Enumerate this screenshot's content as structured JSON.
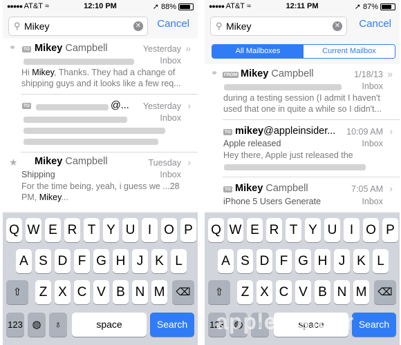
{
  "left": {
    "status": {
      "carrier": "AT&T",
      "time": "12:10 PM",
      "battery": "88%"
    },
    "search": {
      "query": "Mikey",
      "cancel": "Cancel"
    },
    "messages": [
      {
        "first": "Mikey",
        "rest": " Campbell",
        "date": "Yesterday",
        "mailbox": "Inbox",
        "l1_a": "Hi ",
        "l1_b": "Mikey",
        "l1_c": ", Thanks. They had a change of",
        "l2": "shipping guys and it looks like a few req..."
      },
      {
        "date": "Yesterday",
        "mailbox": "Inbox",
        "at": "@..."
      },
      {
        "first": "Mikey",
        "rest": " Campbell",
        "date": "Tuesday",
        "subject": "Shipping",
        "mailbox": "Inbox",
        "l1": "For the time being, yeah, i guess we ...28",
        "l2_a": "PM, ",
        "l2_b": "Mikey",
        "l2_c": "..."
      }
    ],
    "tags": {
      "to": "TO"
    }
  },
  "right": {
    "status": {
      "carrier": "AT&T",
      "time": "12:11 PM",
      "battery": "87%"
    },
    "search": {
      "query": "Mikey",
      "cancel": "Cancel"
    },
    "scope": {
      "all": "All Mailboxes",
      "current": "Current Mailbox"
    },
    "messages": [
      {
        "first": "Mikey",
        "rest": " Campbell",
        "date": "1/18/13",
        "mailbox": "Inbox",
        "l1": "during a testing session (I admit I haven't",
        "l2": "used that one in quite a while so I didn't..."
      },
      {
        "first": "mikey",
        "rest": "@appleinsider...",
        "date": "10:09 AM",
        "subject": "Apple released",
        "mailbox": "Inbox",
        "l1": "Hey there, Apple just released the"
      },
      {
        "first": "Mikey",
        "rest": " Campbell",
        "date": "7:05 AM",
        "subject": "iPhone 5 Users Generate",
        "mailbox": "Inbox"
      }
    ],
    "tags": {
      "from": "FROM",
      "to": "TO"
    }
  },
  "keyboard": {
    "row1": [
      "Q",
      "W",
      "E",
      "R",
      "T",
      "Y",
      "U",
      "I",
      "O",
      "P"
    ],
    "row2": [
      "A",
      "S",
      "D",
      "F",
      "G",
      "H",
      "J",
      "K",
      "L"
    ],
    "row3": [
      "Z",
      "X",
      "C",
      "V",
      "B",
      "N",
      "M"
    ],
    "numbers": "123",
    "space": "space",
    "search": "Search",
    "shift_icon": "shift-icon",
    "delete_icon": "delete-icon",
    "globe_icon": "globe-icon",
    "mic_icon": "mic-icon"
  },
  "watermark": "appleinsider",
  "colors": {
    "accent": "#2f7cf6",
    "keyboard_bg": "#d2d5db"
  }
}
